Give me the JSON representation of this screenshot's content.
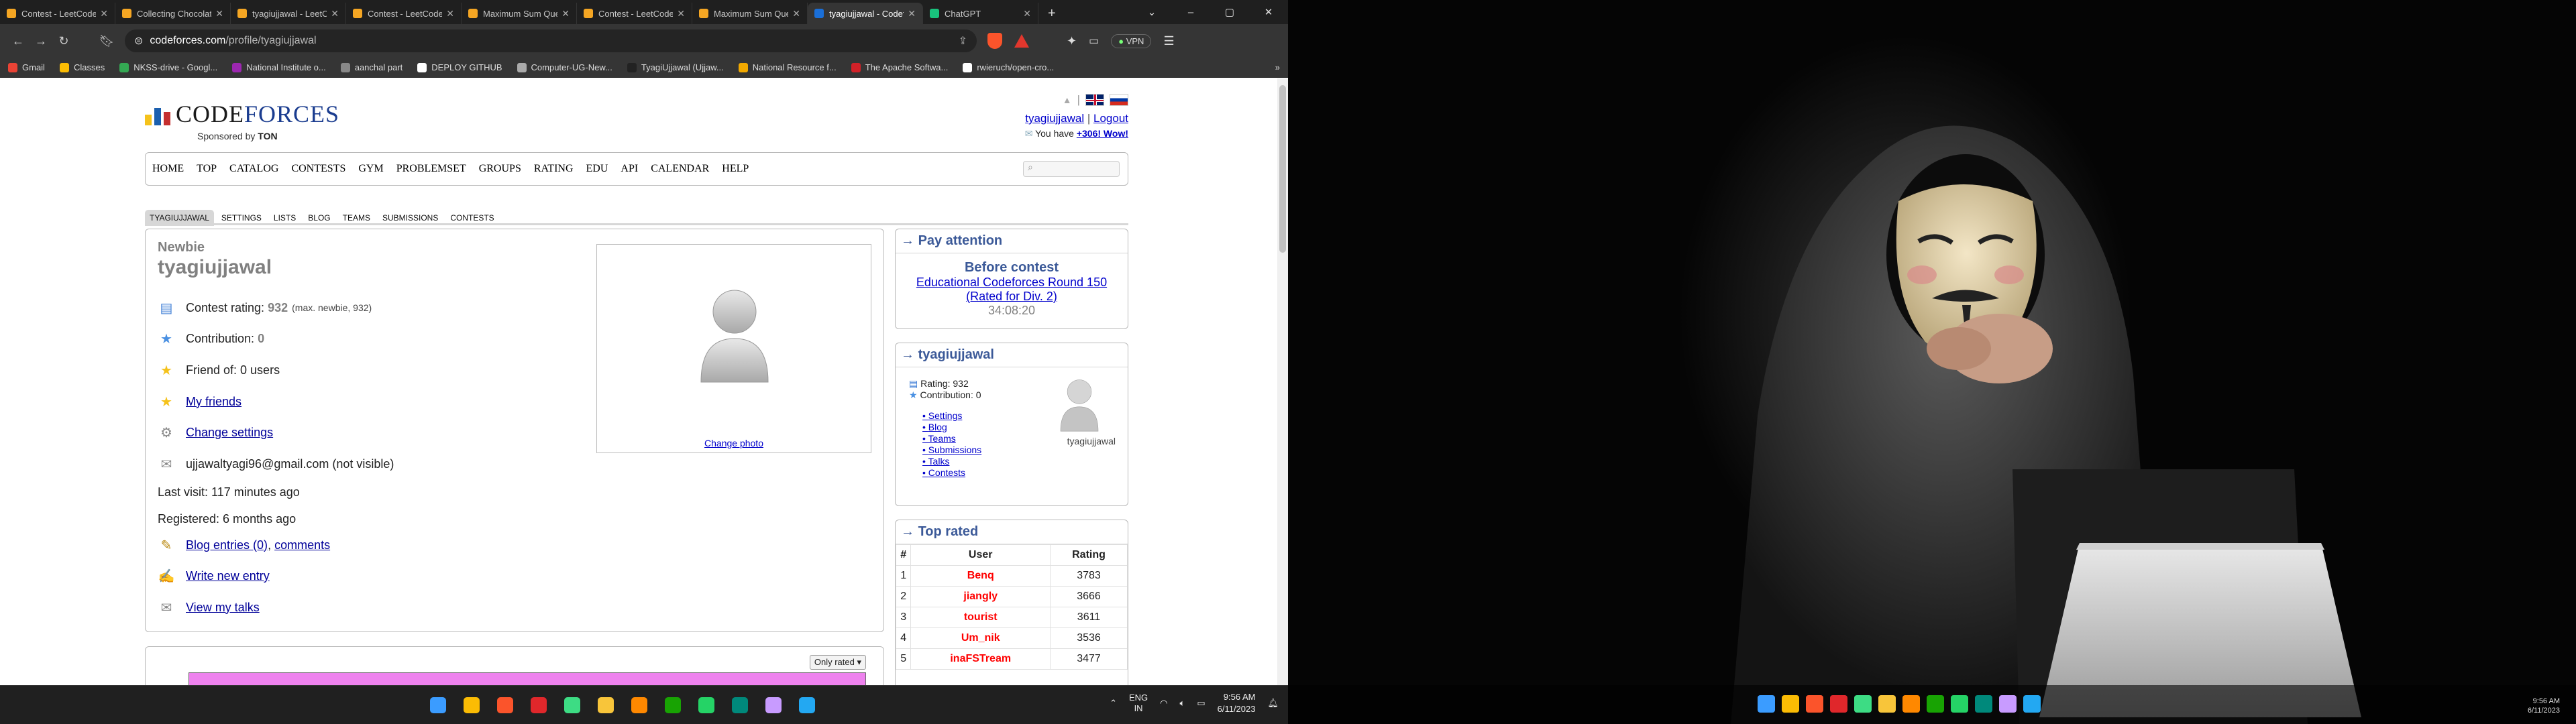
{
  "browser": {
    "tabs": [
      {
        "label": "Contest - LeetCode",
        "color": "#f5a623"
      },
      {
        "label": "Collecting Chocolates",
        "color": "#f5a623"
      },
      {
        "label": "tyagiujjawal - LeetCode",
        "color": "#f5a623"
      },
      {
        "label": "Contest - LeetCode",
        "color": "#f5a623"
      },
      {
        "label": "Maximum Sum Queries",
        "color": "#f5a623"
      },
      {
        "label": "Contest - LeetCode",
        "color": "#f5a623"
      },
      {
        "label": "Maximum Sum Queries",
        "color": "#f5a623"
      },
      {
        "label": "tyagiujjawal - Codeforces",
        "color": "#1a6fd8"
      },
      {
        "label": "ChatGPT",
        "color": "#19c37d"
      }
    ],
    "active_tab_index": 7,
    "url_host": "codeforces.com",
    "url_path": "/profile/tyagiujjawal",
    "vpn_label": "VPN",
    "bookmarks": [
      {
        "label": "Gmail",
        "color": "#ea4335"
      },
      {
        "label": "Classes",
        "color": "#fbbc04"
      },
      {
        "label": "NKSS-drive - Googl...",
        "color": "#34a853"
      },
      {
        "label": "National Institute o...",
        "color": "#9c27b0"
      },
      {
        "label": "aanchal part",
        "color": "#888888"
      },
      {
        "label": "DEPLOY GITHUB",
        "color": "#ffffff"
      },
      {
        "label": "Computer-UG-New...",
        "color": "#aaaaaa"
      },
      {
        "label": "TyagiUjjawal (Ujjaw...",
        "color": "#222222"
      },
      {
        "label": "National Resource f...",
        "color": "#f2a900"
      },
      {
        "label": "The Apache Softwa...",
        "color": "#d22128"
      },
      {
        "label": "rwieruch/open-cro...",
        "color": "#ffffff"
      }
    ]
  },
  "cf": {
    "logo_code": "Code",
    "logo_forces": "forces",
    "sponsored_by": "Sponsored by",
    "sponsor_name": "TON",
    "user_link": "tyagiujjawal",
    "logout": "Logout",
    "you_have": "You have",
    "wow": "+306! Wow!",
    "menu": [
      "HOME",
      "TOP",
      "CATALOG",
      "CONTESTS",
      "GYM",
      "PROBLEMSET",
      "GROUPS",
      "RATING",
      "EDU",
      "API",
      "CALENDAR",
      "HELP"
    ],
    "subnav": [
      "TYAGIUJJAWAL",
      "SETTINGS",
      "LISTS",
      "BLOG",
      "TEAMS",
      "SUBMISSIONS",
      "CONTESTS"
    ],
    "profile": {
      "rank": "Newbie",
      "handle": "tyagiujjawal",
      "contest_rating_label": "Contest rating:",
      "contest_rating": "932",
      "max_info": "(max. newbie, 932)",
      "contribution_label": "Contribution:",
      "contribution": "0",
      "friend_of": "Friend of: 0 users",
      "my_friends": "My friends",
      "change_settings": "Change settings",
      "email": "ujjawaltyagi96@gmail.com (not visible)",
      "last_visit": "Last visit: 117 minutes ago",
      "registered": "Registered: 6 months ago",
      "blog_entries": "Blog entries (0)",
      "comments": "comments",
      "write_entry": "Write new entry",
      "view_talks": "View my talks",
      "change_photo": "Change photo",
      "only_rated": "Only rated"
    },
    "pay_attention": {
      "title": "Pay attention",
      "before": "Before contest",
      "contest": "Educational Codeforces Round 150",
      "rated": "(Rated for Div. 2)",
      "timer": "34:08:20"
    },
    "user_box": {
      "title": "tyagiujjawal",
      "rating_line": "Rating: 932",
      "contribution_line": "Contribution: 0",
      "links": [
        "Settings",
        "Blog",
        "Teams",
        "Submissions",
        "Talks",
        "Contests"
      ],
      "avatar_name": "tyagiujjawal"
    },
    "top_rated": {
      "title": "Top rated",
      "headers": [
        "#",
        "User",
        "Rating"
      ],
      "rows": [
        {
          "rank": "1",
          "user": "Benq",
          "rating": "3783"
        },
        {
          "rank": "2",
          "user": "jiangly",
          "rating": "3666"
        },
        {
          "rank": "3",
          "user": "tourist",
          "rating": "3611"
        },
        {
          "rank": "4",
          "user": "Um_nik",
          "rating": "3536"
        },
        {
          "rank": "5",
          "user": "inaFSTream",
          "rating": "3477"
        }
      ]
    }
  },
  "taskbar": {
    "icons": [
      {
        "name": "windows-start-icon",
        "color": "#3b9cff"
      },
      {
        "name": "chrome-icon",
        "color": "#fbbc04"
      },
      {
        "name": "brave-icon",
        "color": "#fb542b"
      },
      {
        "name": "opera-icon",
        "color": "#e0272b"
      },
      {
        "name": "android-studio-icon",
        "color": "#3ddc84"
      },
      {
        "name": "file-explorer-icon",
        "color": "#f8c53a"
      },
      {
        "name": "vlc-icon",
        "color": "#ff8800"
      },
      {
        "name": "libreoffice-icon",
        "color": "#18a303"
      },
      {
        "name": "whatsapp-icon",
        "color": "#25d366"
      },
      {
        "name": "meet-icon",
        "color": "#00897b"
      },
      {
        "name": "app-icon",
        "color": "#c89bff"
      },
      {
        "name": "vscode-icon",
        "color": "#23a8f2"
      }
    ],
    "lang1": "ENG",
    "lang2": "IN",
    "time": "9:56 AM",
    "date": "6/11/2023"
  },
  "taskbar2": {
    "time": "9:56 AM",
    "date": "6/11/2023"
  }
}
